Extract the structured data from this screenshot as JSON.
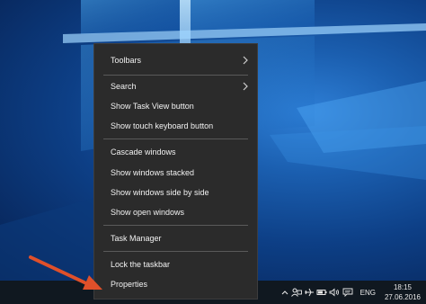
{
  "menu": {
    "items": [
      {
        "label": "Toolbars",
        "submenu": true
      },
      {
        "label": "Search",
        "submenu": true
      },
      {
        "label": "Show Task View button"
      },
      {
        "label": "Show touch keyboard button"
      },
      {
        "label": "Cascade windows"
      },
      {
        "label": "Show windows stacked"
      },
      {
        "label": "Show windows side by side"
      },
      {
        "label": "Show open windows"
      },
      {
        "label": "Task Manager"
      },
      {
        "label": "Lock the taskbar"
      },
      {
        "label": "Properties"
      }
    ]
  },
  "tray": {
    "icons": [
      "chevron-up-icon",
      "people-icon",
      "airplane-icon",
      "battery-icon",
      "volume-icon",
      "action-center-icon"
    ],
    "language": "ENG",
    "time": "18:15",
    "date": "27.06.2016"
  },
  "colors": {
    "menu_bg": "#2b2b2b",
    "menu_text": "#f2f2f2",
    "taskbar": "#101820",
    "annotation_arrow": "#e0502a"
  }
}
